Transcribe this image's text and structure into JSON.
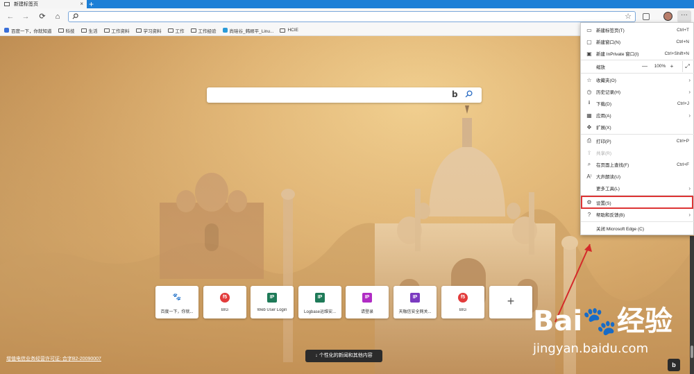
{
  "tab": {
    "title": "新建标签页",
    "close": "×",
    "new_tab": "+"
  },
  "toolbar": {
    "back": "←",
    "forward": "→",
    "refresh": "⟳",
    "home": "⌂",
    "address_value": "",
    "favorite": "☆",
    "menu": "···"
  },
  "bookmarks": [
    {
      "label": "百度一下，你就知道",
      "icon": "baidu-favicon"
    },
    {
      "label": "科技",
      "icon": "folder-icon"
    },
    {
      "label": "生活",
      "icon": "folder-icon"
    },
    {
      "label": "工作资料",
      "icon": "folder-icon"
    },
    {
      "label": "学习资料",
      "icon": "folder-icon"
    },
    {
      "label": "工作",
      "icon": "folder-icon"
    },
    {
      "label": "工作经验",
      "icon": "folder-icon"
    },
    {
      "label": "尚硅谷_韩顺平_Linu...",
      "icon": "site-favicon"
    },
    {
      "label": "HCIE",
      "icon": "folder-icon"
    }
  ],
  "search": {
    "placeholder": "",
    "bing": "b"
  },
  "quick_links": [
    {
      "label": "百度一下，你就...",
      "icon_text": "🐾",
      "color": "#2d6be0"
    },
    {
      "label": "BIG",
      "icon_text": "f5",
      "color": "#e23b3b"
    },
    {
      "label": "Web User Login",
      "icon_text": "IP",
      "color": "#1e7a58"
    },
    {
      "label": "Logbase运维安...",
      "icon_text": "IP",
      "color": "#1e7a58"
    },
    {
      "label": "请登录",
      "icon_text": "IP",
      "color": "#b02cc4"
    },
    {
      "label": "天融信安全网关...",
      "icon_text": "IP",
      "color": "#7b3ac0"
    },
    {
      "label": "BIG",
      "icon_text": "f5",
      "color": "#e23b3b"
    }
  ],
  "add_link": "+",
  "footer": {
    "license": "增值电信业务经营许可证: 合字B2-20090007",
    "news_button": "↓ 个性化的新闻和其他内容",
    "bing_corner": "b"
  },
  "watermark": {
    "main": "Bai🐾经验",
    "url": "jingyan.baidu.com"
  },
  "menu": {
    "new_tab": {
      "label": "新建标签页(T)",
      "shortcut": "Ctrl+T"
    },
    "new_window": {
      "label": "新建窗口(N)",
      "shortcut": "Ctrl+N"
    },
    "new_inprivate": {
      "label": "新建 InPrivate 窗口(I)",
      "shortcut": "Ctrl+Shift+N"
    },
    "zoom": {
      "label": "缩放",
      "minus": "—",
      "value": "100%",
      "plus": "+",
      "fullscreen": "⤢"
    },
    "favorites": {
      "label": "收藏夹(O)",
      "arrow": "›"
    },
    "history": {
      "label": "历史记录(H)",
      "arrow": "›"
    },
    "downloads": {
      "label": "下载(D)",
      "shortcut": "Ctrl+J"
    },
    "apps": {
      "label": "应用(A)",
      "arrow": "›"
    },
    "extensions": {
      "label": "扩展(X)"
    },
    "print": {
      "label": "打印(P)",
      "shortcut": "Ctrl+P"
    },
    "share": {
      "label": "共享(R)"
    },
    "find": {
      "label": "在页面上查找(F)",
      "shortcut": "Ctrl+F"
    },
    "read_aloud": {
      "label": "大声朗读(U)"
    },
    "more_tools": {
      "label": "更多工具(L)",
      "arrow": "›"
    },
    "settings": {
      "label": "设置(S)"
    },
    "help": {
      "label": "帮助和反馈(B)",
      "arrow": "›"
    },
    "close_edge": {
      "label": "关闭 Microsoft Edge (C)"
    }
  },
  "colors": {
    "tab_strip": "#1d7fd6",
    "highlight": "#dd3333",
    "annotation_arrow": "#d42a2a"
  }
}
